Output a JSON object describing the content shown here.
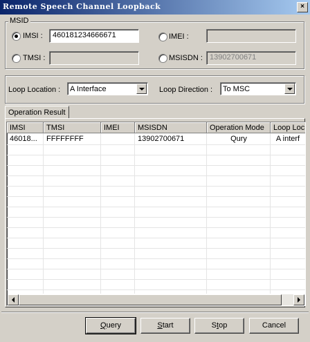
{
  "window": {
    "title": "Remote Speech Channel Loopback",
    "close_label": "×"
  },
  "msid": {
    "legend": "MSID",
    "imsi": {
      "label": "IMSI :",
      "value": "460181234666671",
      "selected": true
    },
    "tmsi": {
      "label": "TMSI :",
      "value": ""
    },
    "imei": {
      "label": "IMEI :",
      "value": ""
    },
    "msisdn": {
      "label": "MSISDN :",
      "value": "13902700671"
    }
  },
  "loop": {
    "location_label": "Loop Location :",
    "location_value": "A Interface",
    "direction_label": "Loop Direction :",
    "direction_value": "To MSC"
  },
  "tab": {
    "label": "Operation Result"
  },
  "table": {
    "headers": [
      "IMSI",
      "TMSI",
      "IMEI",
      "MSISDN",
      "Operation Mode",
      "Loop Loc"
    ],
    "rows": [
      [
        "46018...",
        "FFFFFFFF",
        "",
        "13902700671",
        "Qury",
        "A interf"
      ]
    ]
  },
  "buttons": {
    "query_pre": "",
    "query_ul": "Q",
    "query_post": "uery",
    "start_pre": "",
    "start_ul": "S",
    "start_post": "tart",
    "stop_pre": "S",
    "stop_ul": "t",
    "stop_post": "op",
    "cancel": "Cancel"
  }
}
